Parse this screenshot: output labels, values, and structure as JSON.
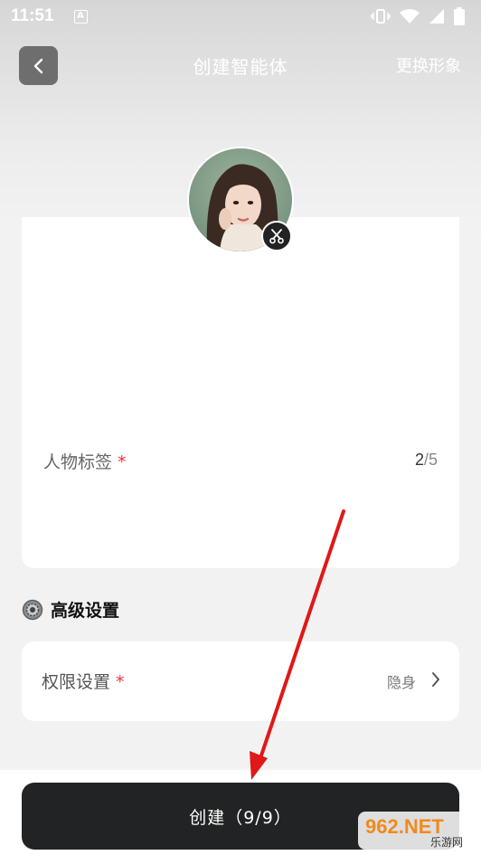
{
  "status_bar": {
    "time": "11:51",
    "a_badge": "A",
    "icons": [
      "vibrate-icon",
      "wifi-icon",
      "cellular-icon",
      "battery-icon"
    ]
  },
  "header": {
    "title": "创建智能体",
    "right_action": "更换形象"
  },
  "character_tags": {
    "label": "人物标签",
    "required_mark": "*",
    "count_current": "2",
    "count_separator": "/",
    "count_max": "5"
  },
  "advanced": {
    "title": "高级设置",
    "permission": {
      "label": "权限设置",
      "required_mark": "*",
      "value": "隐身"
    }
  },
  "create_button": {
    "label": "创建（9/9）"
  },
  "watermark": {
    "text": "962.NET",
    "sub": "乐游网"
  },
  "colors": {
    "button_bg": "#222324",
    "required": "#e33333",
    "annotation_arrow": "#e01818"
  }
}
